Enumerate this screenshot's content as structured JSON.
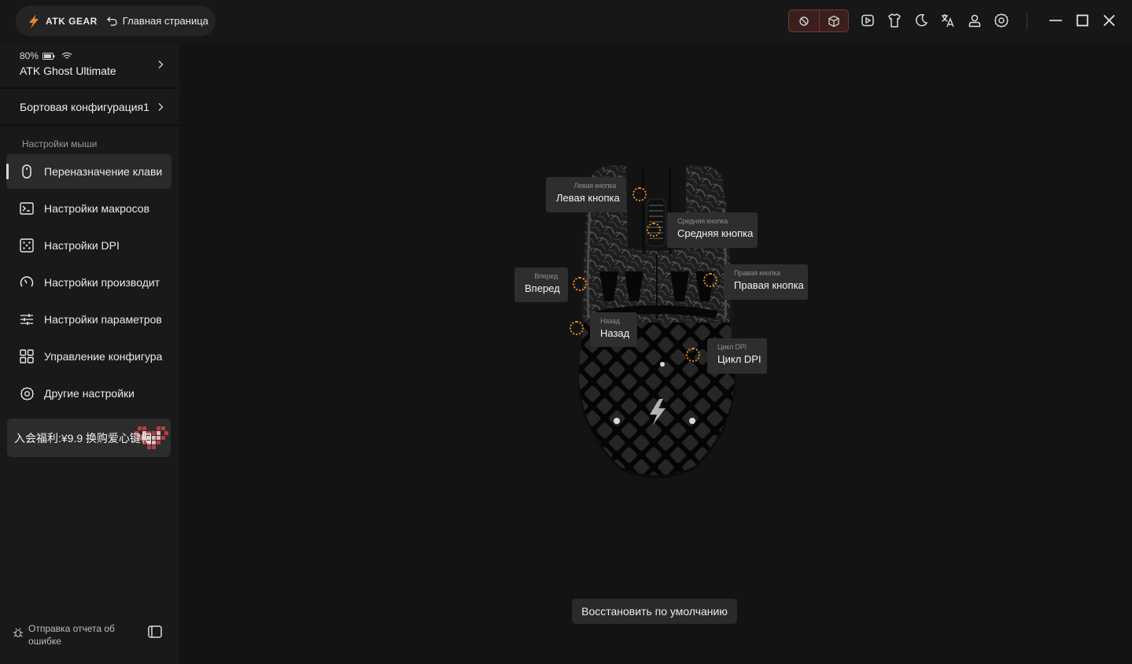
{
  "titlebar": {
    "brand": "ATK GEAR",
    "home_label": "Главная страница",
    "icons": [
      "sleep-mode-icon",
      "3d-box-icon",
      "video-icon",
      "shirt-icon",
      "moon-icon",
      "translate-icon",
      "user-icon",
      "settings-icon"
    ],
    "window_controls": [
      "minimize",
      "maximize",
      "close"
    ]
  },
  "sidebar": {
    "device": {
      "battery": "80%",
      "name": "ATK Ghost Ultimate"
    },
    "config_label": "Бортовая конфигурация1",
    "section_label": "Настройки мыши",
    "items": [
      {
        "label": "Переназначение клави",
        "icon": "mouse-icon",
        "active": true
      },
      {
        "label": "Настройки макросов",
        "icon": "terminal-icon",
        "active": false
      },
      {
        "label": "Настройки DPI",
        "icon": "dpi-icon",
        "active": false
      },
      {
        "label": "Настройки производит",
        "icon": "performance-gauge-icon",
        "active": false
      },
      {
        "label": "Настройки параметров",
        "icon": "sliders-icon",
        "active": false
      },
      {
        "label": "Управление конфигура",
        "icon": "grid-icon",
        "active": false
      },
      {
        "label": "Другие настройки",
        "icon": "gear-icon",
        "active": false
      }
    ],
    "promo": "入会福利:¥9.9 换购爱心键帽",
    "bug_report": "Отправка отчета об ошибке"
  },
  "main": {
    "buttons": {
      "left": {
        "sub": "Левая кнопка",
        "main": "Левая кнопка"
      },
      "middle": {
        "sub": "Средняя кнопка",
        "main": "Средняя кнопка"
      },
      "forward": {
        "sub": "Вперед",
        "main": "Вперед"
      },
      "right": {
        "sub": "Правая кнопка",
        "main": "Правая кнопка"
      },
      "back": {
        "sub": "Назад",
        "main": "Назад"
      },
      "dpi": {
        "sub": "Цикл DPI",
        "main": "Цикл DPI"
      }
    },
    "restore_label": "Восстановить по умолчанию"
  },
  "colors": {
    "accent": "#e58a2c",
    "status_bg": "#3a1f1d",
    "panel": "#191919",
    "background": "#131313"
  }
}
